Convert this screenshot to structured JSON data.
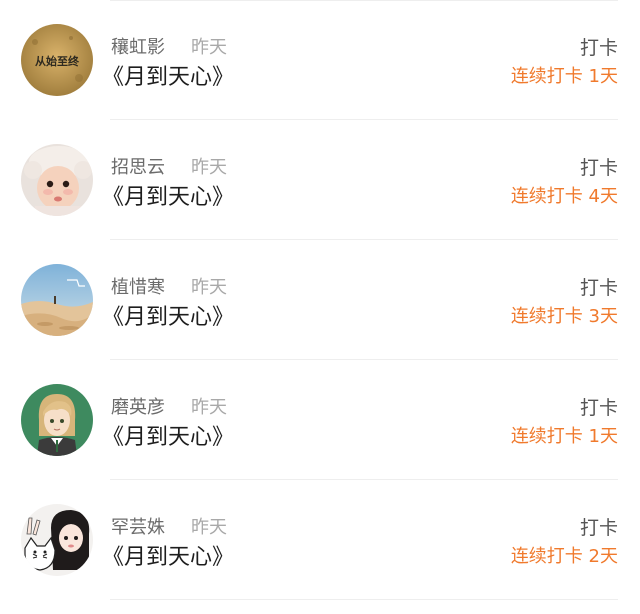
{
  "entries": [
    {
      "name": "穰虹影",
      "time": "昨天",
      "book": "《月到天心》",
      "checkin_label": "打卡",
      "streak": "连续打卡 1天",
      "avatar_icon": "avatar-text-badge",
      "avatar_text": "从始至终"
    },
    {
      "name": "招思云",
      "time": "昨天",
      "book": "《月到天心》",
      "checkin_label": "打卡",
      "streak": "连续打卡 4天",
      "avatar_icon": "avatar-baby-photo"
    },
    {
      "name": "植惜寒",
      "time": "昨天",
      "book": "《月到天心》",
      "checkin_label": "打卡",
      "streak": "连续打卡 3天",
      "avatar_icon": "avatar-desert-landscape"
    },
    {
      "name": "磨英彦",
      "time": "昨天",
      "book": "《月到天心》",
      "checkin_label": "打卡",
      "streak": "连续打卡 1天",
      "avatar_icon": "avatar-anime-character"
    },
    {
      "name": "罕芸姝",
      "time": "昨天",
      "book": "《月到天心》",
      "checkin_label": "打卡",
      "streak": "连续打卡 2天",
      "avatar_icon": "avatar-cartoon-girl-cat"
    }
  ],
  "colors": {
    "accent_orange": "#f07a2d",
    "name_gray": "#6b6b6b",
    "time_gray": "#a9a9a9",
    "title_black": "#1e1e1e",
    "separator": "#eeeeee"
  }
}
